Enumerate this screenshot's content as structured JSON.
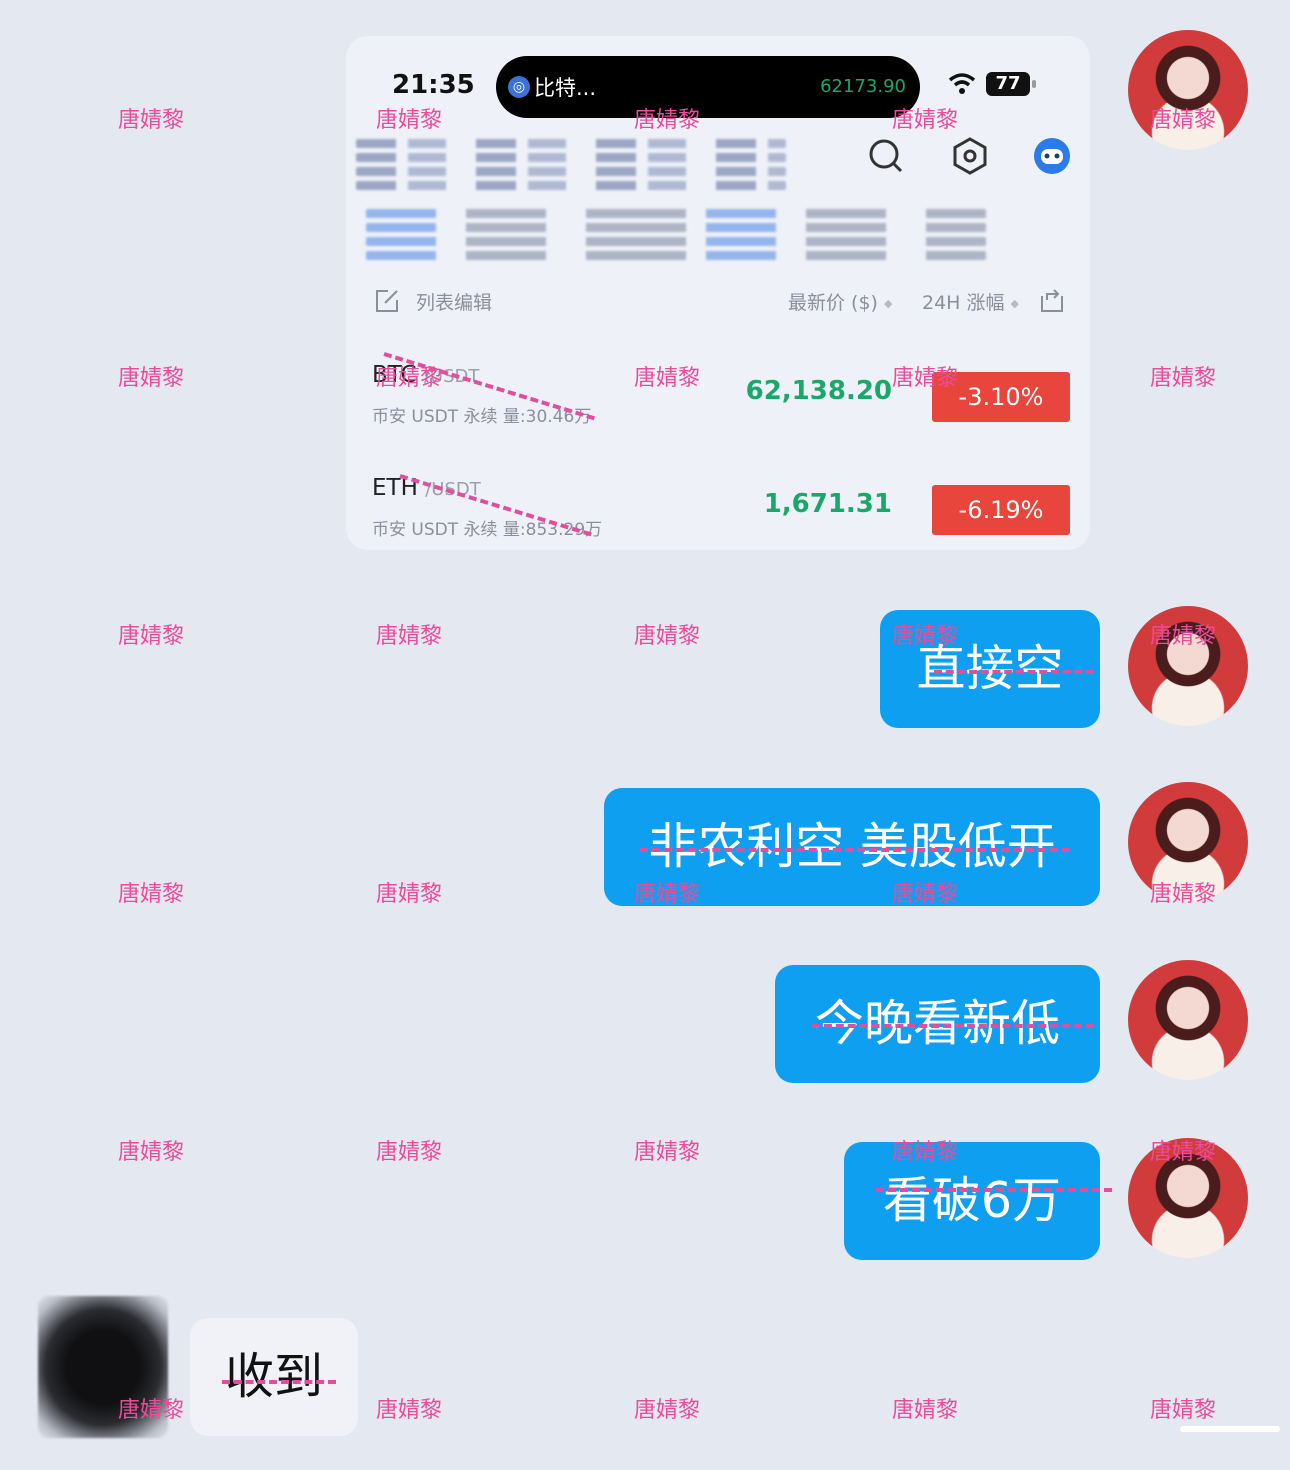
{
  "screenshot": {
    "status_bar": {
      "time": "21:35",
      "island_app_label": "比特...",
      "island_price": "62173.90",
      "battery": "77"
    },
    "list_header": {
      "edit_label": "列表编辑",
      "price_col": "最新价 ($)",
      "change_col": "24H 涨幅"
    },
    "coins": [
      {
        "symbol": "BTC",
        "quote": "/USDT",
        "sub": "币安 USDT 永续  量:30.46万",
        "price": "62,138.20",
        "change": "-3.10%"
      },
      {
        "symbol": "ETH",
        "quote": "/USDT",
        "sub": "币安 USDT 永续  量:853.29万",
        "price": "1,671.31",
        "change": "-6.19%"
      }
    ]
  },
  "messages": [
    {
      "text": "直接空"
    },
    {
      "text": "非农利空 美股低开"
    },
    {
      "text": "今晚看新低"
    },
    {
      "text": "看破6万"
    }
  ],
  "reply": {
    "text": "收到"
  },
  "watermark": "唐婧黎",
  "colors": {
    "bubble": "#0e9ff0",
    "up_green": "#1aa76a",
    "down_red": "#e8453c",
    "watermark": "#ea4c9b"
  }
}
